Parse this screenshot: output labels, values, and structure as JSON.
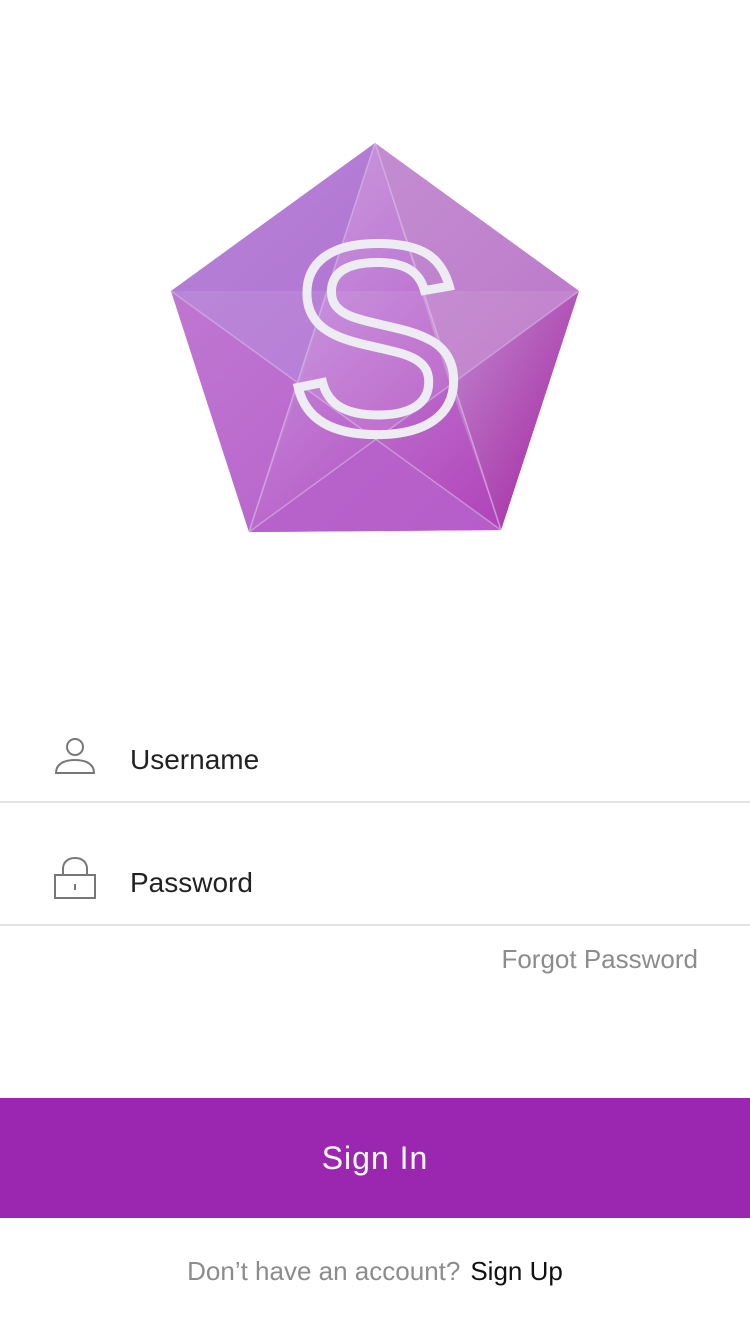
{
  "logo": {
    "letter": "S",
    "icon": "pentagon-logo-icon",
    "colors": {
      "primary": "#b96ad1",
      "dark": "#a020a8",
      "light": "#c9a6dc",
      "letter": "#ececf2"
    }
  },
  "form": {
    "username": {
      "placeholder": "Username",
      "icon": "user-icon"
    },
    "password": {
      "placeholder": "Password",
      "icon": "lock-icon"
    },
    "forgot_label": "Forgot Password"
  },
  "actions": {
    "sign_in_label": "Sign In",
    "accent_color": "#9b27b0"
  },
  "footer": {
    "prompt": "Don’t have an account?",
    "sign_up_label": "Sign Up"
  }
}
